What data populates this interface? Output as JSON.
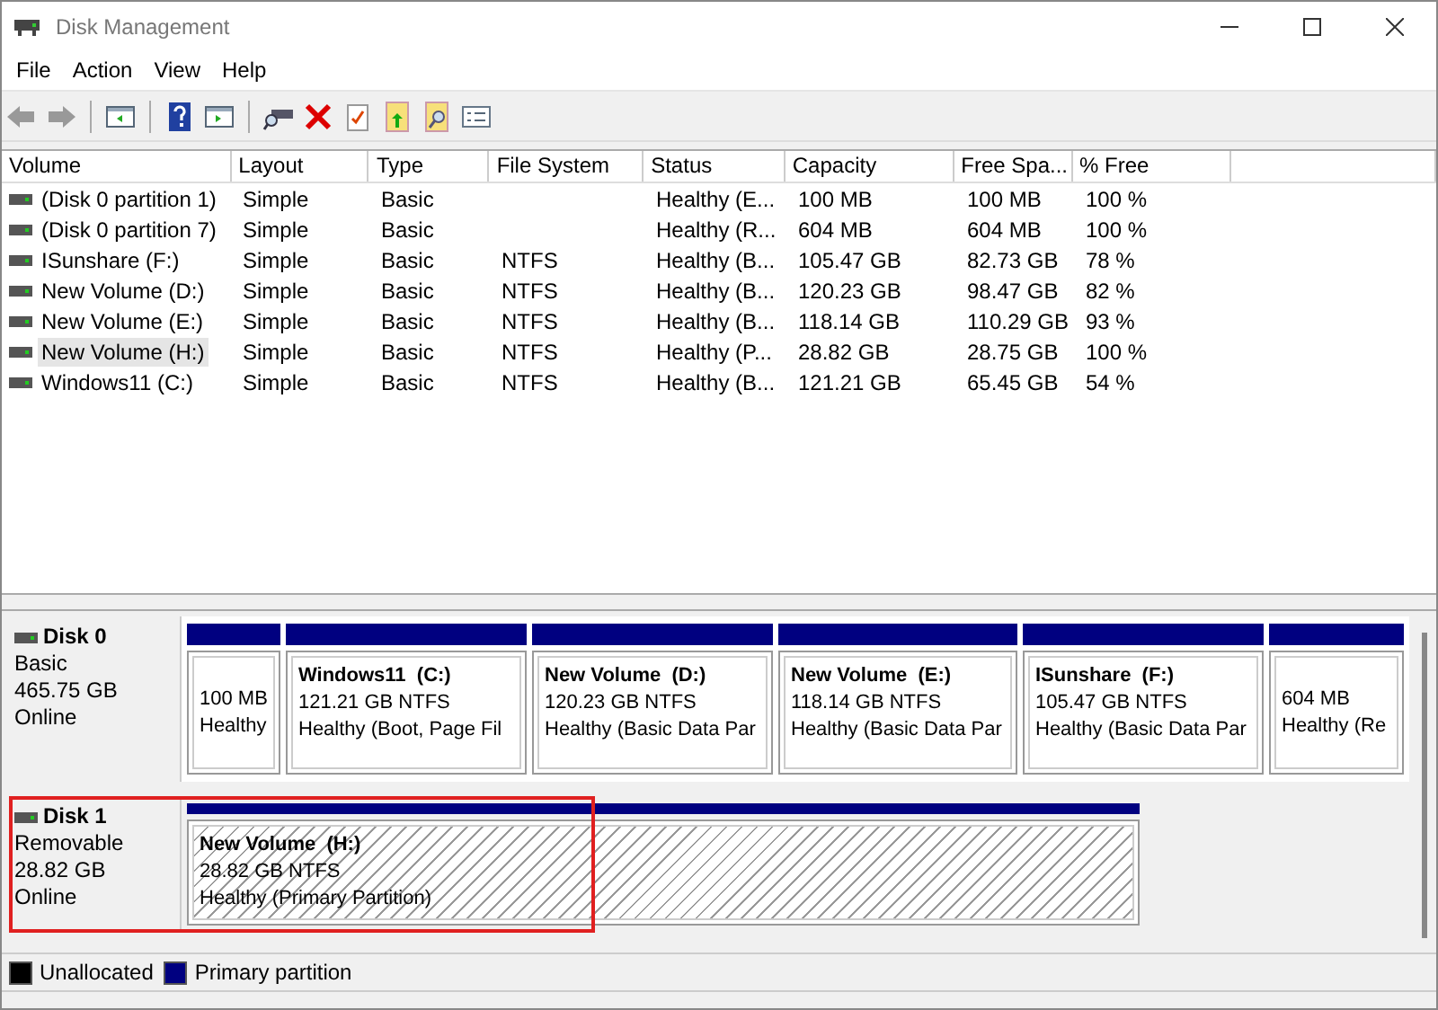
{
  "window": {
    "title": "Disk Management"
  },
  "menu": [
    "File",
    "Action",
    "View",
    "Help"
  ],
  "volume_table": {
    "columns": [
      "Volume",
      "Layout",
      "Type",
      "File System",
      "Status",
      "Capacity",
      "Free Spa...",
      "% Free"
    ],
    "rows": [
      {
        "cells": [
          "(Disk 0 partition 1)",
          "Simple",
          "Basic",
          "",
          "Healthy (E...",
          "100 MB",
          "100 MB",
          "100 %"
        ],
        "selected": false
      },
      {
        "cells": [
          "(Disk 0 partition 7)",
          "Simple",
          "Basic",
          "",
          "Healthy (R...",
          "604 MB",
          "604 MB",
          "100 %"
        ],
        "selected": false
      },
      {
        "cells": [
          "ISunshare (F:)",
          "Simple",
          "Basic",
          "NTFS",
          "Healthy (B...",
          "105.47 GB",
          "82.73 GB",
          "78 %"
        ],
        "selected": false
      },
      {
        "cells": [
          "New Volume (D:)",
          "Simple",
          "Basic",
          "NTFS",
          "Healthy (B...",
          "120.23 GB",
          "98.47 GB",
          "82 %"
        ],
        "selected": false
      },
      {
        "cells": [
          "New Volume (E:)",
          "Simple",
          "Basic",
          "NTFS",
          "Healthy (B...",
          "118.14 GB",
          "110.29 GB",
          "93 %"
        ],
        "selected": false
      },
      {
        "cells": [
          "New Volume (H:)",
          "Simple",
          "Basic",
          "NTFS",
          "Healthy (P...",
          "28.82 GB",
          "28.75 GB",
          "100 %"
        ],
        "selected": true
      },
      {
        "cells": [
          "Windows11 (C:)",
          "Simple",
          "Basic",
          "NTFS",
          "Healthy (B...",
          "121.21 GB",
          "65.45 GB",
          "54 %"
        ],
        "selected": false
      }
    ]
  },
  "disks": [
    {
      "name": "Disk 0",
      "type": "Basic",
      "size": "465.75 GB",
      "status": "Online",
      "highlighted": false,
      "partitions": [
        {
          "size": "100 MB",
          "status": "Healthy",
          "selected": false
        },
        {
          "name": "Windows11  (C:)",
          "size": "121.21 GB NTFS",
          "status": "Healthy (Boot, Page Fil",
          "selected": false
        },
        {
          "name": "New Volume  (D:)",
          "size": "120.23 GB NTFS",
          "status": "Healthy (Basic Data Par",
          "selected": false
        },
        {
          "name": "New Volume  (E:)",
          "size": "118.14 GB NTFS",
          "status": "Healthy (Basic Data Par",
          "selected": false
        },
        {
          "name": "ISunshare  (F:)",
          "size": "105.47 GB NTFS",
          "status": "Healthy (Basic Data Par",
          "selected": false
        },
        {
          "size": "604 MB",
          "status": "Healthy (Re",
          "selected": false
        }
      ]
    },
    {
      "name": "Disk 1",
      "type": "Removable",
      "size": "28.82 GB",
      "status": "Online",
      "highlighted": true,
      "partitions": [
        {
          "name": "New Volume  (H:)",
          "size": "28.82 GB NTFS",
          "status": "Healthy (Primary Partition)",
          "selected": true
        }
      ]
    }
  ],
  "legend": [
    {
      "label": "Unallocated",
      "color": "#000000"
    },
    {
      "label": "Primary partition",
      "color": "#000080"
    }
  ]
}
